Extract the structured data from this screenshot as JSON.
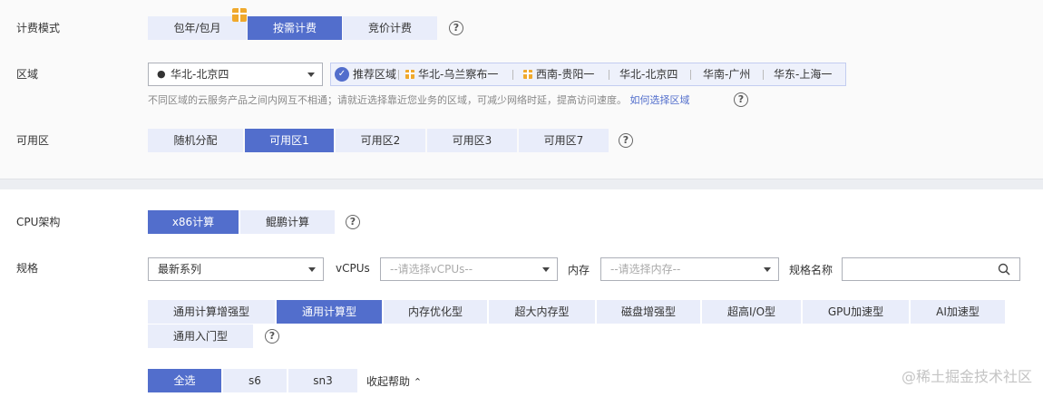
{
  "billing": {
    "label": "计费模式",
    "options": [
      "包年/包月",
      "按需计费",
      "竞价计费"
    ],
    "selected": "按需计费"
  },
  "region": {
    "label": "区域",
    "value": "华北-北京四",
    "recommend_label": "推荐区域",
    "recommended": [
      "华北-乌兰察布一",
      "西南-贵阳一",
      "华北-北京四",
      "华南-广州",
      "华东-上海一"
    ],
    "hint": "不同区域的云服务产品之间内网互不相通；请就近选择靠近您业务的区域，可减少网络时延，提高访问速度。",
    "hint_link": "如何选择区域"
  },
  "az": {
    "label": "可用区",
    "options": [
      "随机分配",
      "可用区1",
      "可用区2",
      "可用区3",
      "可用区7"
    ],
    "selected": "可用区1"
  },
  "cpu_arch": {
    "label": "CPU架构",
    "options": [
      "x86计算",
      "鲲鹏计算"
    ],
    "selected": "x86计算"
  },
  "spec": {
    "label": "规格",
    "series_value": "最新系列",
    "vcpus_label": "vCPUs",
    "vcpus_placeholder": "--请选择vCPUs--",
    "mem_label": "内存",
    "mem_placeholder": "--请选择内存--",
    "name_label": "规格名称",
    "types": [
      "通用计算增强型",
      "通用计算型",
      "内存优化型",
      "超大内存型",
      "磁盘增强型",
      "超高I/O型",
      "GPU加速型",
      "AI加速型",
      "通用入门型"
    ],
    "selected_type": "通用计算型",
    "filters": [
      "全选",
      "s6",
      "sn3"
    ],
    "selected_filter": "全选",
    "collapse_help": "收起帮助"
  },
  "watermark": "@稀土掘金技术社区",
  "colors": {
    "accent": "#526ecc",
    "segment_bg": "#e9edfa",
    "gift": "#f0a92c"
  }
}
